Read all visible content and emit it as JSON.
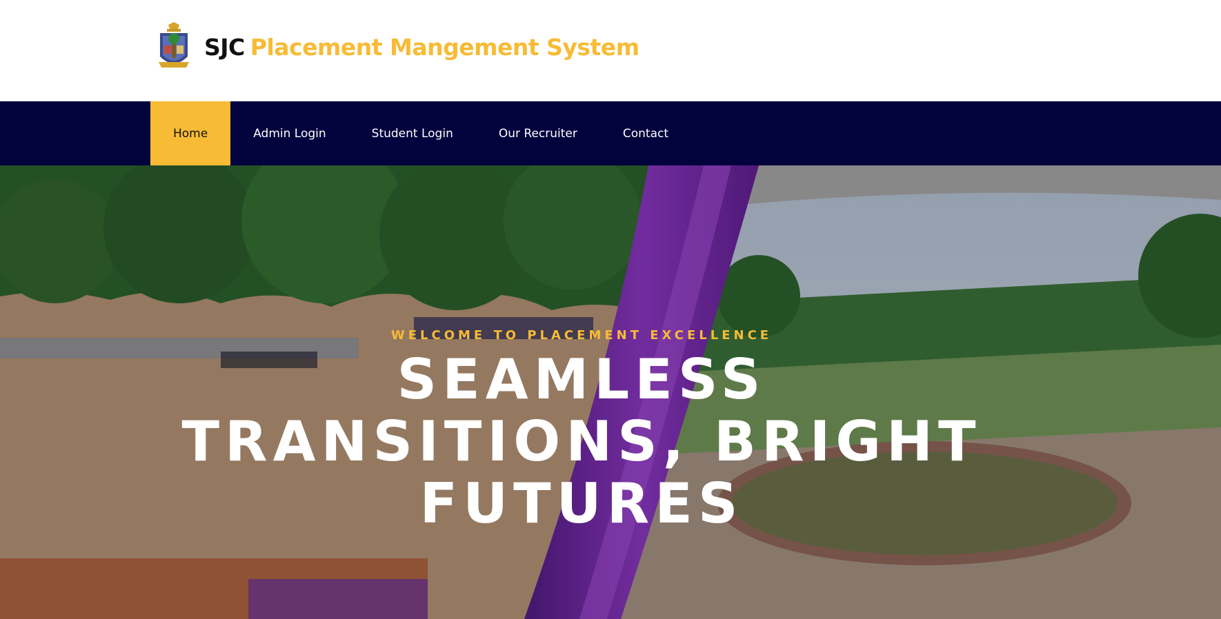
{
  "brand": {
    "logo_icon": "college-crest-icon",
    "prefix": "SJC",
    "name": "Placement Mangement System",
    "prefix_color": "#111111",
    "accent_color": "#f7bb35"
  },
  "nav": {
    "background": "#02033d",
    "items": [
      {
        "label": "Home",
        "active": true
      },
      {
        "label": "Admin Login",
        "active": false
      },
      {
        "label": "Student Login",
        "active": false
      },
      {
        "label": "Our Recruiter",
        "active": false
      },
      {
        "label": "Contact",
        "active": false
      }
    ]
  },
  "hero": {
    "kicker": "WELCOME TO PLACEMENT EXCELLENCE",
    "title_lines": [
      "SEAMLESS",
      "TRANSITIONS, BRIGHT",
      "FUTURES"
    ]
  }
}
